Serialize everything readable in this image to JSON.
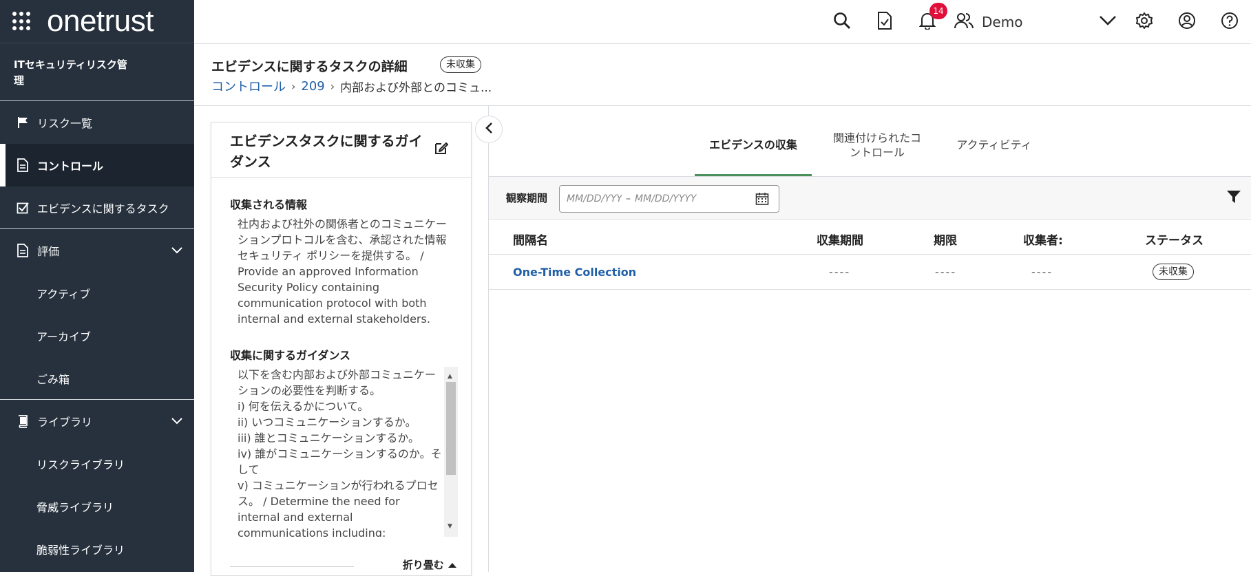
{
  "brand": {
    "logo_text": "onetrust",
    "app_name": "ITセキュリティリスク管理"
  },
  "sidebar": {
    "items": [
      {
        "label": "リスク一覧"
      },
      {
        "label": "コントロール"
      },
      {
        "label": "エビデンスに関するタスク"
      },
      {
        "label": "評価"
      },
      {
        "label": "アクティブ"
      },
      {
        "label": "アーカイブ"
      },
      {
        "label": "ごみ箱"
      },
      {
        "label": "ライブラリ"
      },
      {
        "label": "リスクライブラリ"
      },
      {
        "label": "脅威ライブラリ"
      },
      {
        "label": "脆弱性ライブラリ"
      }
    ]
  },
  "topbar": {
    "notification_count": "14",
    "user_name": "Demo"
  },
  "header": {
    "title": "エビデンスに関するタスクの詳細",
    "status_pill": "未収集",
    "breadcrumb": {
      "item1": "コントロール",
      "item2": "209",
      "item3": "内部および外部とのコミュ..."
    }
  },
  "guidance": {
    "title": "エビデンスタスクに関するガイダンス",
    "info_title": "収集される情報",
    "info_body": "社内および社外の関係者とのコミュニケーションプロトコルを含む、承認された情報セキュリティ ポリシーを提供する。 / Provide an approved Information Security Policy containing communication protocol with both internal and external stakeholders.",
    "guide_title": "収集に関するガイダンス",
    "guide_body": "以下を含む内部および外部コミュニケーションの必要性を判断する。\ni) 何を伝えるかについて。\nii) いつコミュニケーションするか。\niii) 誰とコミュニケーションするか。\niv) 誰がコミュニケーションするのか。そして\nv) コミュニケーションが行われるプロセス。 / Determine the need for internal and external communications including:",
    "collapse_label": "折り畳む"
  },
  "tabs": [
    {
      "label": "エビデンスの収集"
    },
    {
      "label": "関連付けられたコントロール"
    },
    {
      "label": "アクティビティ"
    }
  ],
  "filter": {
    "label": "観察期間",
    "date_from_placeholder": "MM/DD/YYYY",
    "date_sep": "–",
    "date_to_placeholder": "MM/DD/YYYY"
  },
  "table": {
    "headers": {
      "interval": "間隔名",
      "period": "収集期間",
      "due": "期限",
      "collector": "収集者:",
      "status": "ステータス"
    },
    "rows": [
      {
        "interval": "One-Time Collection",
        "period": "----",
        "due": "----",
        "collector": "----",
        "status": "未収集"
      }
    ]
  },
  "colors": {
    "sidebar_bg": "#26313d",
    "link": "#1f5fa8",
    "tab_active": "#4b8f5b",
    "badge": "#e0103a"
  }
}
